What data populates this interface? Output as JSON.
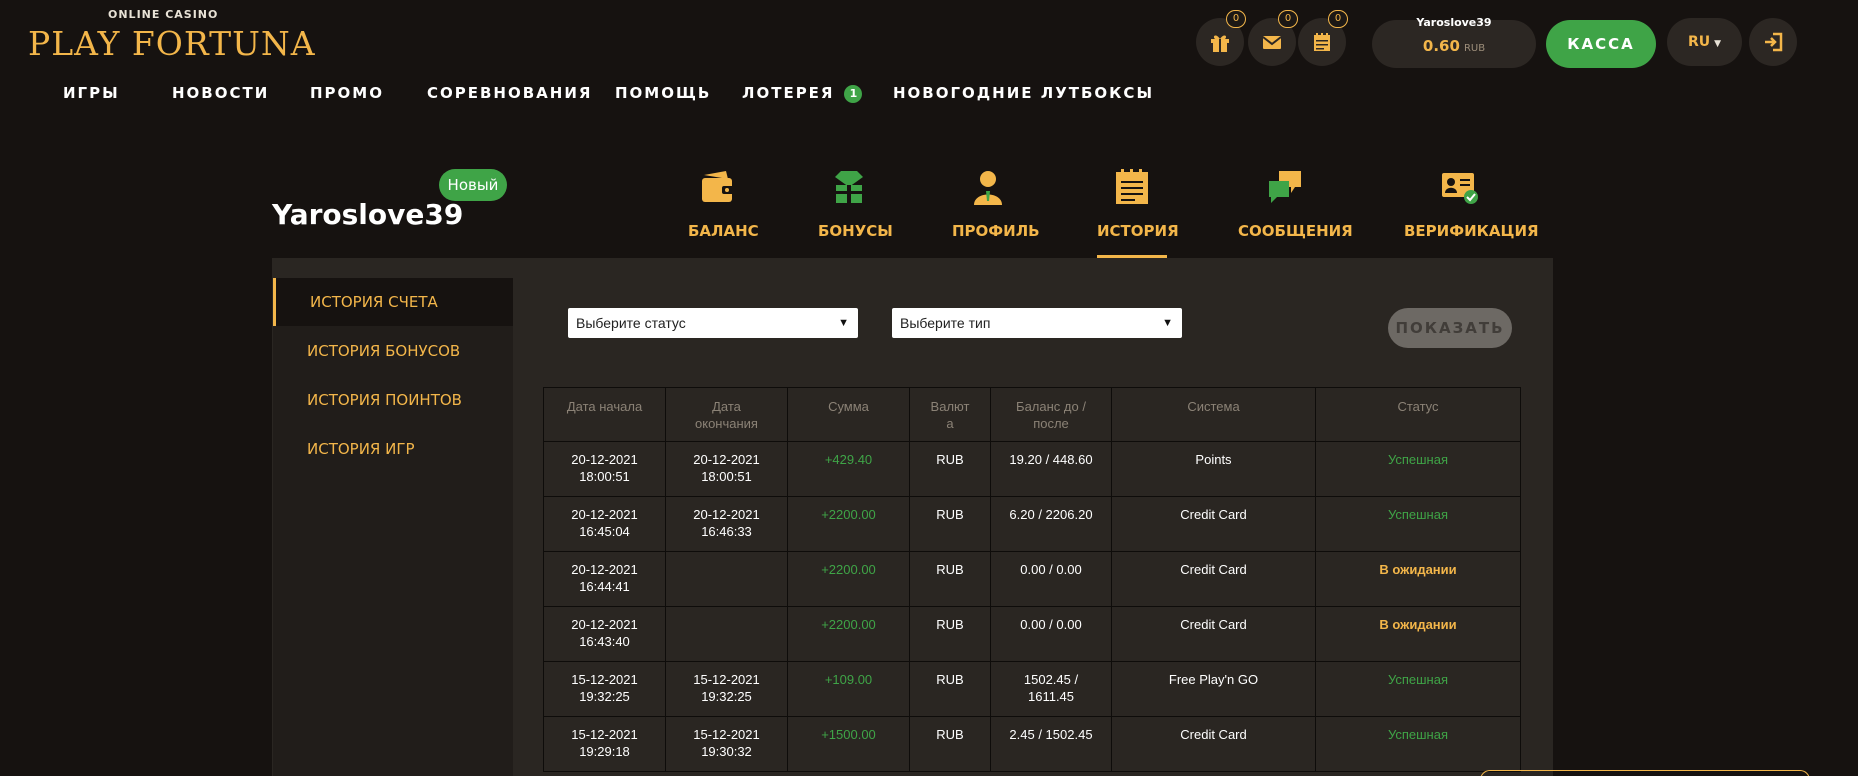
{
  "logo": {
    "small": "ONLINE CASINO",
    "main": "PLAY FORTUNA"
  },
  "nav": [
    {
      "label": "ИГРЫ"
    },
    {
      "label": "НОВОСТИ"
    },
    {
      "label": "ПРОМО"
    },
    {
      "label": "СОРЕВНОВАНИЯ"
    },
    {
      "label": "ПОМОЩЬ"
    },
    {
      "label": "ЛОТЕРЕЯ",
      "badge": "1"
    },
    {
      "label": "НОВОГОДНИЕ ЛУТБОКСЫ"
    }
  ],
  "header": {
    "gift_count": "0",
    "mail_count": "0",
    "calendar_count": "0",
    "balance_user": "Yaroslove39",
    "balance_amount": "0.60",
    "balance_currency": "RUB",
    "cashier_label": "КАССА",
    "language": "RU"
  },
  "profile": {
    "username": "Yaroslove39",
    "status_badge": "Новый",
    "tabs": [
      {
        "label": "БАЛАНС",
        "icon": "wallet-icon"
      },
      {
        "label": "БОНУСЫ",
        "icon": "gift-box-icon"
      },
      {
        "label": "ПРОФИЛЬ",
        "icon": "user-icon"
      },
      {
        "label": "ИСТОРИЯ",
        "icon": "notepad-icon",
        "active": true
      },
      {
        "label": "СООБЩЕНИЯ",
        "icon": "chat-icon"
      },
      {
        "label": "ВЕРИФИКАЦИЯ",
        "icon": "id-card-check-icon"
      }
    ]
  },
  "sidebar": {
    "items": [
      {
        "label": "ИСТОРИЯ СЧЕТА",
        "active": true
      },
      {
        "label": "ИСТОРИЯ БОНУСОВ"
      },
      {
        "label": "ИСТОРИЯ ПОИНТОВ"
      },
      {
        "label": "ИСТОРИЯ ИГР"
      }
    ]
  },
  "filters": {
    "status_placeholder": "Выберите статус",
    "type_placeholder": "Выберите тип",
    "show_label": "ПОКАЗАТЬ"
  },
  "table": {
    "headers": {
      "start": [
        "Дата начала"
      ],
      "end": [
        "Дата",
        "окончания"
      ],
      "amount": [
        "Сумма"
      ],
      "currency": [
        "Валют",
        "а"
      ],
      "balance": [
        "Баланс до /",
        "после"
      ],
      "system": [
        "Система"
      ],
      "status": [
        "Статус"
      ]
    },
    "rows": [
      {
        "start": [
          "20-12-2021",
          "18:00:51"
        ],
        "end": [
          "20-12-2021",
          "18:00:51"
        ],
        "amount": "+429.40",
        "currency": "RUB",
        "balance": [
          "19.20 / 448.60"
        ],
        "system": "Points",
        "status": "Успешная",
        "status_kind": "ok"
      },
      {
        "start": [
          "20-12-2021",
          "16:45:04"
        ],
        "end": [
          "20-12-2021",
          "16:46:33"
        ],
        "amount": "+2200.00",
        "currency": "RUB",
        "balance": [
          "6.20 / 2206.20"
        ],
        "system": "Credit Card",
        "status": "Успешная",
        "status_kind": "ok"
      },
      {
        "start": [
          "20-12-2021",
          "16:44:41"
        ],
        "end": [],
        "amount": "+2200.00",
        "currency": "RUB",
        "balance": [
          "0.00 / 0.00"
        ],
        "system": "Credit Card",
        "status": "В ожидании",
        "status_kind": "wait"
      },
      {
        "start": [
          "20-12-2021",
          "16:43:40"
        ],
        "end": [],
        "amount": "+2200.00",
        "currency": "RUB",
        "balance": [
          "0.00 / 0.00"
        ],
        "system": "Credit Card",
        "status": "В ожидании",
        "status_kind": "wait"
      },
      {
        "start": [
          "15-12-2021",
          "19:32:25"
        ],
        "end": [
          "15-12-2021",
          "19:32:25"
        ],
        "amount": "+109.00",
        "currency": "RUB",
        "balance": [
          "1502.45 /",
          "1611.45"
        ],
        "system": "Free Play'n GO",
        "status": "Успешная",
        "status_kind": "ok"
      },
      {
        "start": [
          "15-12-2021",
          "19:29:18"
        ],
        "end": [
          "15-12-2021",
          "19:30:32"
        ],
        "amount": "+1500.00",
        "currency": "RUB",
        "balance": [
          "2.45 / 1502.45"
        ],
        "system": "Credit Card",
        "status": "Успешная",
        "status_kind": "ok"
      }
    ]
  },
  "colors": {
    "accent": "#f3b64a",
    "green": "#3fa447",
    "bg": "#161210",
    "panel": "#2a2622"
  }
}
